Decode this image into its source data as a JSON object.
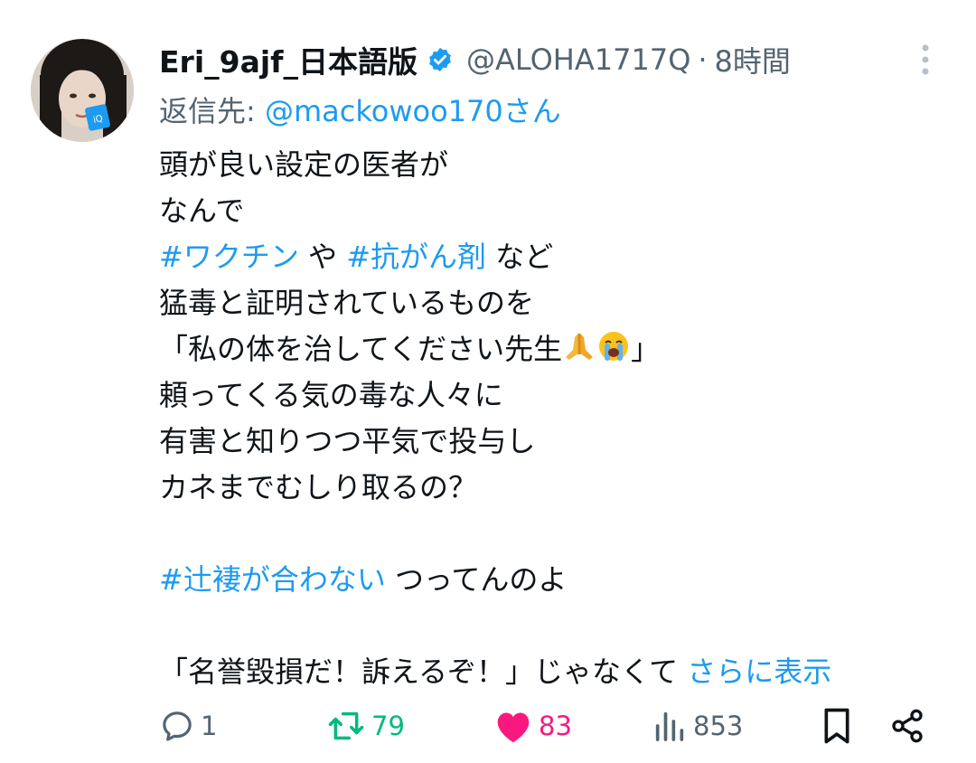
{
  "tweet": {
    "author": {
      "display_name": "Eri_9ajf_日本語版",
      "handle": "@ALOHA1717Q",
      "verified": true,
      "avatar_badge_text": "iQ"
    },
    "separator": "·",
    "time": "8時間",
    "reply_to": {
      "prefix": "返信先:",
      "mention": "@mackowoo170さん"
    },
    "body": {
      "line1": "頭が良い設定の医者が",
      "line2": "なんで",
      "line3_tag1": "#ワクチン",
      "line3_mid": " や ",
      "line3_tag2": "#抗がん剤",
      "line3_end": " など",
      "line4": "猛毒と証明されているものを",
      "line5_text": "「私の体を治してください先生",
      "line5_end": "」",
      "line6": "頼ってくる気の毒な人々に",
      "line7": "有害と知りつつ平気で投与し",
      "line8": "カネまでむしり取るの？",
      "line10_tag": "#辻褄が合わない",
      "line10_end": " つってんのよ",
      "line12_text": "「名誉毀損だ！訴えるぞ！」じゃなくて ",
      "show_more": "さらに表示"
    },
    "emojis": [
      "folded-hands",
      "loudly-crying-face"
    ],
    "actions": {
      "replies": "1",
      "retweets": "79",
      "likes": "83",
      "views": "853"
    },
    "colors": {
      "accent": "#1d9bf0",
      "retweet": "#00ba7c",
      "like": "#f91880",
      "muted": "#536471",
      "text": "#0f1419"
    }
  }
}
